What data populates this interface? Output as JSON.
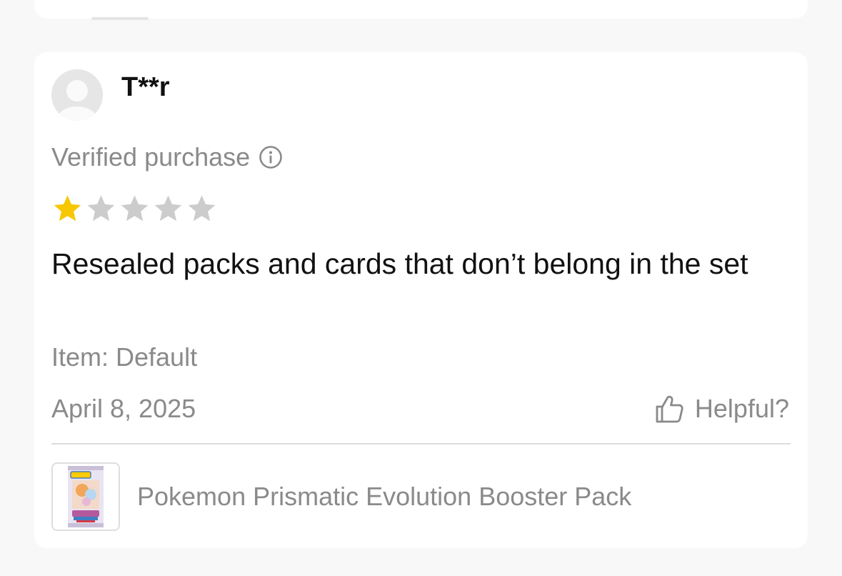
{
  "review": {
    "username": "T**r",
    "verified_label": "Verified purchase",
    "rating": 1,
    "rating_max": 5,
    "text": "Resealed packs and cards that don’t belong in the set",
    "item_variant": "Item: Default",
    "date": "April 8, 2025",
    "helpful_label": "Helpful?"
  },
  "product": {
    "name": "Pokemon Prismatic Evolution Booster Pack",
    "thumbnail_brand": "Pokémon",
    "thumbnail_set": "PRISMATIC"
  },
  "icons": {
    "avatar": "user-silhouette-icon",
    "info": "info-circle-icon",
    "star": "star-icon",
    "helpful": "thumbs-up-icon"
  },
  "colors": {
    "star_filled": "#f7c800",
    "star_empty": "#cccccc",
    "muted_text": "#8a8a8a",
    "primary_text": "#111111"
  }
}
